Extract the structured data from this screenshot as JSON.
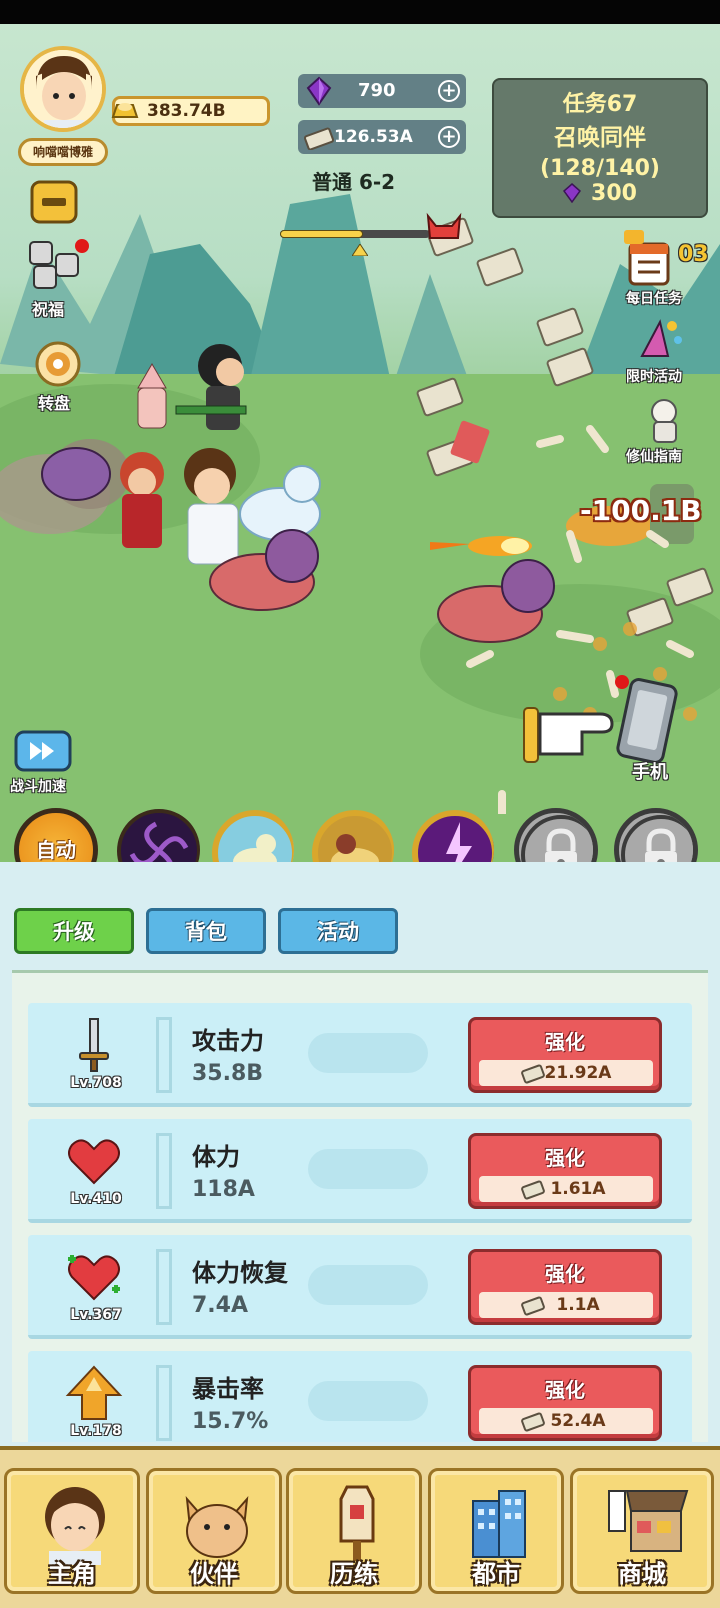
{
  "player": {
    "name": "响噹噹博雅",
    "gold": "383.74B"
  },
  "resources": {
    "gems": "790",
    "cash": "126.53A",
    "add_symbol": "+"
  },
  "stage": {
    "label": "普通 6-2",
    "progress": 0.55
  },
  "mission": {
    "title": "任务67",
    "name": "召唤同伴",
    "progress": "(128/140)",
    "reward": "300"
  },
  "side_left": {
    "blessing": "祝福",
    "wheel": "转盘",
    "speed": "战斗加速"
  },
  "side_right": {
    "daily": "每日任务",
    "daily_count": "03",
    "limited": "限时活动",
    "guide": "修仙指南",
    "phone": "手机"
  },
  "battle": {
    "damage": "-100.1B"
  },
  "skills": {
    "auto_label": "自动"
  },
  "tabs": [
    "升级",
    "背包",
    "活动"
  ],
  "upgrades": [
    {
      "name": "攻击力",
      "value": "35.8B",
      "level": "Lv.708",
      "button": "强化",
      "cost": "21.92A",
      "icon": "sword-icon"
    },
    {
      "name": "体力",
      "value": "118A",
      "level": "Lv.410",
      "button": "强化",
      "cost": "1.61A",
      "icon": "heart-icon"
    },
    {
      "name": "体力恢复",
      "value": "7.4A",
      "level": "Lv.367",
      "button": "强化",
      "cost": "1.1A",
      "icon": "heart-plus-icon"
    },
    {
      "name": "暴击率",
      "value": "15.7%",
      "level": "Lv.178",
      "button": "强化",
      "cost": "52.4A",
      "icon": "crit-icon"
    }
  ],
  "nav": [
    "主角",
    "伙伴",
    "历练",
    "都市",
    "商城"
  ],
  "colors": {
    "accent_green": "#6ed14a",
    "tab_blue": "#5bb7e6",
    "upgrade_red": "#ea5a5c",
    "nav_gold": "#f6d979"
  }
}
